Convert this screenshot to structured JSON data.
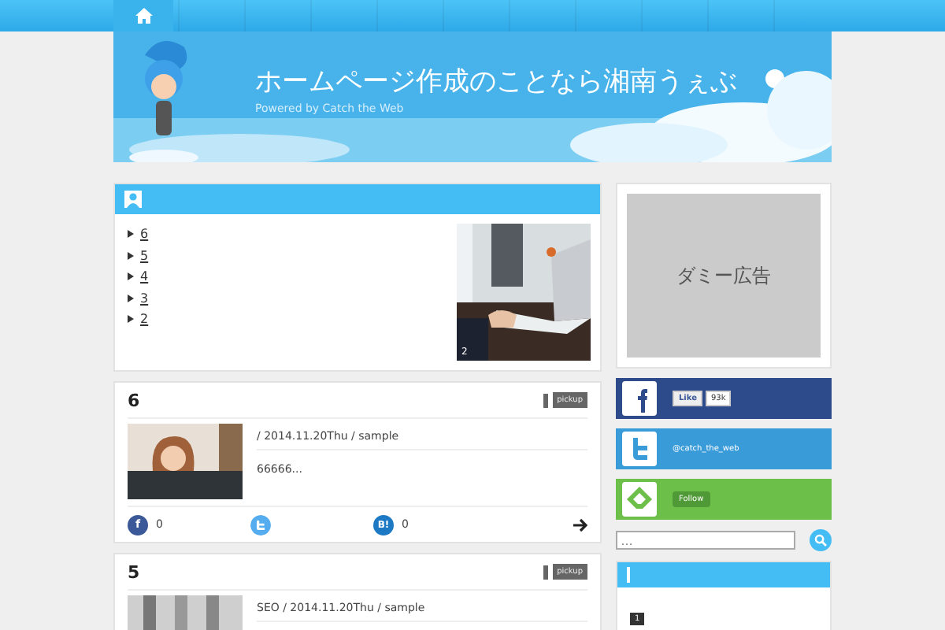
{
  "header": {
    "title": "ホームページ作成のことなら湘南うぇぶ",
    "subtitle": "Powered by Catch the Web"
  },
  "recent": {
    "items": [
      "6",
      "5",
      "4",
      "3",
      "2"
    ],
    "slide_caption": "2"
  },
  "posts": [
    {
      "title": "6",
      "tag": "pickup",
      "meta": "/ 2014.11.20Thu / sample",
      "excerpt": "66666...",
      "shares": {
        "facebook_icon": "f",
        "facebook": "0",
        "hatena_icon": "B!",
        "hatena": "0"
      }
    },
    {
      "title": "5",
      "tag": "pickup",
      "meta": "SEO / 2014.11.20Thu / sample"
    }
  ],
  "sidebar": {
    "ad": "ダミー広告",
    "social": [
      {
        "kind": "facebook",
        "color": "#2d4a8a",
        "label": "Like",
        "count": "93k"
      },
      {
        "kind": "twitter",
        "color": "#3a9bd9",
        "label": "@catch_the_web"
      },
      {
        "kind": "feedly",
        "color": "#6cc04a",
        "label": "Follow"
      }
    ],
    "search": {
      "placeholder": "…"
    },
    "list": [
      "1"
    ]
  }
}
